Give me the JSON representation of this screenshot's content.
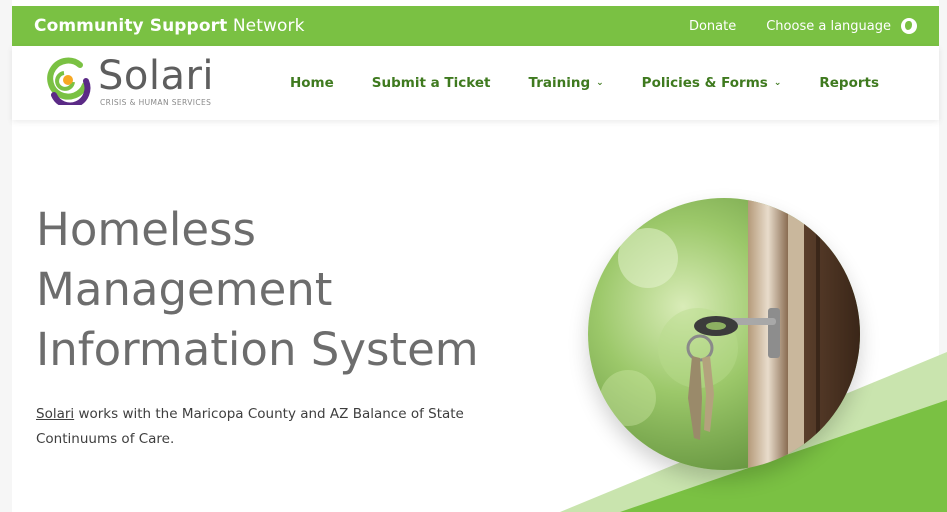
{
  "topbar": {
    "brand_bold": "Community Support",
    "brand_rest": " Network",
    "donate": "Donate",
    "language": "Choose a language",
    "globe_icon": "globe-icon"
  },
  "logo": {
    "name": "Solari",
    "tagline": "CRISIS & HUMAN SERVICES"
  },
  "nav": {
    "home": "Home",
    "submit_ticket": "Submit a Ticket",
    "training": "Training",
    "policies": "Policies & Forms",
    "reports": "Reports"
  },
  "hero": {
    "title_line1": "Homeless",
    "title_line2": "Management",
    "title_line3": "Information System",
    "desc_link": "Solari",
    "desc_rest_line1": " works with the Maricopa County and AZ Balance of State",
    "desc_line2": "Continuums of Care."
  },
  "colors": {
    "brand_green": "#7ac143",
    "nav_green": "#3f7a1f",
    "logo_purple": "#5b2a86",
    "logo_orange": "#f7a823"
  }
}
